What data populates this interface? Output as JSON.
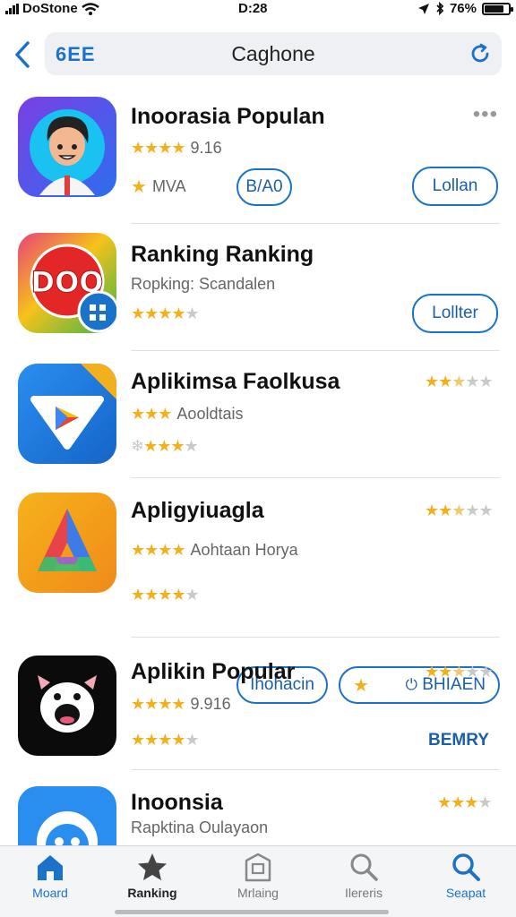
{
  "status_bar": {
    "carrier": "DoStone",
    "time": "D:28",
    "battery": "76%"
  },
  "search": {
    "scope": "6EE",
    "query": "Caghone"
  },
  "apps": [
    {
      "title": "Inoorasia Populan",
      "rating_text": "9.16",
      "tag_text": "MVA",
      "secondary_button": "B/A0",
      "primary_button": "Lollan",
      "rating": 4
    },
    {
      "title": "Ranking Ranking",
      "subtitle": "Ropking: Scandalen",
      "primary_button": "Lollter",
      "rating": 4
    },
    {
      "title": "Aplikimsa Faolkusa",
      "subtitle": "Aooldtais",
      "rating": 3,
      "rating_right": 2.5
    },
    {
      "title": "Apligyiuagla",
      "subtitle": "Aohtaan Horya",
      "rating": 4,
      "rating_right": 2.5,
      "secondary_button": "Ihohacin",
      "primary_button": "BHIAEN"
    },
    {
      "title": "Aplikin Popular",
      "rating_text": "9.916",
      "rating": 4,
      "rating_right": 2.5,
      "link": "BEMRY"
    },
    {
      "title": "Inoonsia",
      "subtitle": "Rapktina Oulayaon",
      "rating_right": 3
    }
  ],
  "tabs": [
    {
      "label": "Moard",
      "icon": "home-icon"
    },
    {
      "label": "Ranking",
      "icon": "star-icon"
    },
    {
      "label": "Mrlaing",
      "icon": "inbox-icon"
    },
    {
      "label": "Ilereris",
      "icon": "search-icon"
    },
    {
      "label": "Seapat",
      "icon": "search-icon"
    }
  ],
  "colors": {
    "accent": "#1a73c9",
    "star": "#f2b01e",
    "star_off": "#c9c9c9",
    "tab_bg": "#f4f5f7"
  }
}
